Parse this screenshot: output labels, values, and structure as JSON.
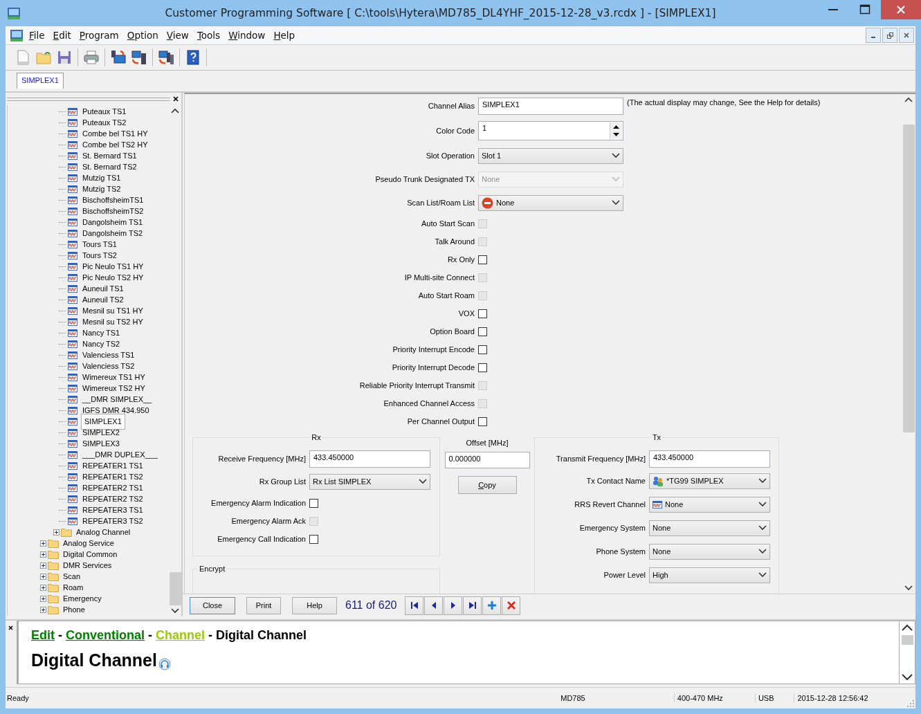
{
  "window": {
    "title": "Customer Programming Software [ C:\\tools\\Hytera\\MD785_DL4YHF_2015-12-28_v3.rcdx ] - [SIMPLEX1]"
  },
  "menu": [
    "File",
    "Edit",
    "Program",
    "Option",
    "View",
    "Tools",
    "Window",
    "Help"
  ],
  "tabs": [
    {
      "label": "SIMPLEX1",
      "selected": true
    }
  ],
  "tree": [
    {
      "children": [
        {
          "children": [
            {
              "label": "Puteaux TS1",
              "selected": false
            },
            {
              "label": "Puteaux TS2",
              "selected": false
            },
            {
              "label": "Combe bel TS1 HY",
              "selected": false
            },
            {
              "label": "Combe bel TS2 HY",
              "selected": false
            },
            {
              "label": "St. Bernard TS1",
              "selected": false
            },
            {
              "label": "St. Bernard TS2",
              "selected": false
            },
            {
              "label": "Mutzig TS1",
              "selected": false
            },
            {
              "label": "Mutzig TS2",
              "selected": false
            },
            {
              "label": "BischoffsheimTS1",
              "selected": false
            },
            {
              "label": "BischoffsheimTS2",
              "selected": false
            },
            {
              "label": "Dangolsheim TS1",
              "selected": false
            },
            {
              "label": "Dangolsheim TS2",
              "selected": false
            },
            {
              "label": "Tours TS1",
              "selected": false
            },
            {
              "label": "Tours TS2",
              "selected": false
            },
            {
              "label": "Pic Neulo TS1 HY",
              "selected": false
            },
            {
              "label": "Pic Neulo TS2 HY",
              "selected": false
            },
            {
              "label": "Auneuil TS1",
              "selected": false
            },
            {
              "label": "Auneuil TS2",
              "selected": false
            },
            {
              "label": "Mesnil su TS1 HY",
              "selected": false
            },
            {
              "label": "Mesnil su TS2 HY",
              "selected": false
            },
            {
              "label": "Nancy TS1",
              "selected": false
            },
            {
              "label": "Nancy TS2",
              "selected": false
            },
            {
              "label": "Valenciess TS1",
              "selected": false
            },
            {
              "label": "Valenciess TS2",
              "selected": false
            },
            {
              "label": "Wimereux TS1 HY",
              "selected": false
            },
            {
              "label": "Wimereux TS2 HY",
              "selected": false
            },
            {
              "label": "__DMR SIMPLEX__",
              "selected": false
            },
            {
              "label": "IGFS DMR 434.950",
              "selected": false
            },
            {
              "label": "SIMPLEX1",
              "selected": true
            },
            {
              "label": "SIMPLEX2",
              "selected": false
            },
            {
              "label": "SIMPLEX3",
              "selected": false
            },
            {
              "label": "___DMR DUPLEX___",
              "selected": false
            },
            {
              "label": "REPEATER1 TS1",
              "selected": false
            },
            {
              "label": "REPEATER1 TS2",
              "selected": false
            },
            {
              "label": "REPEATER2 TS1",
              "selected": false
            },
            {
              "label": "REPEATER2 TS2",
              "selected": false
            },
            {
              "label": "REPEATER3 TS1",
              "selected": false
            },
            {
              "label": "REPEATER3 TS2",
              "selected": false
            }
          ]
        },
        {
          "label": "Analog Channel",
          "expanded": false
        }
      ]
    },
    {
      "label": "Analog Service",
      "expanded": false
    },
    {
      "label": "Digital Common",
      "expanded": false
    },
    {
      "label": "DMR Services",
      "expanded": false
    },
    {
      "label": "Scan",
      "expanded": false
    },
    {
      "label": "Roam",
      "expanded": false
    },
    {
      "label": "Emergency",
      "expanded": false
    },
    {
      "label": "Phone",
      "expanded": false
    }
  ],
  "fields": [
    {
      "kind": "text",
      "label": "Channel Alias",
      "value": "SIMPLEX1",
      "note": "(The actual display may change, See the Help for details)"
    },
    {
      "kind": "spinner",
      "label": "Color Code",
      "value": "1"
    },
    {
      "kind": "select",
      "label": "Slot Operation",
      "value": "Slot 1",
      "disabled": false
    },
    {
      "kind": "select",
      "label": "Pseudo Trunk Designated TX",
      "value": "None",
      "disabled": true
    },
    {
      "kind": "noneselect",
      "label": "Scan List/Roam List",
      "value": "None",
      "disabled": false
    },
    {
      "kind": "checkbox",
      "label": "Auto Start Scan",
      "checked": false,
      "disabled": true
    },
    {
      "kind": "checkbox",
      "label": "Talk Around",
      "checked": false,
      "disabled": true
    },
    {
      "kind": "checkbox",
      "label": "Rx Only",
      "checked": false,
      "disabled": false
    },
    {
      "kind": "checkbox",
      "label": "IP Multi-site Connect",
      "checked": false,
      "disabled": true
    },
    {
      "kind": "checkbox",
      "label": "Auto Start Roam",
      "checked": false,
      "disabled": true
    },
    {
      "kind": "checkbox",
      "label": "VOX",
      "checked": false,
      "disabled": false
    },
    {
      "kind": "checkbox",
      "label": "Option Board",
      "checked": false,
      "disabled": false
    },
    {
      "kind": "checkbox",
      "label": "Priority Interrupt Encode",
      "checked": false,
      "disabled": false
    },
    {
      "kind": "checkbox",
      "label": "Priority Interrupt Decode",
      "checked": false,
      "disabled": false
    },
    {
      "kind": "checkbox",
      "label": "Reliable Priority Interrupt Transmit",
      "checked": false,
      "disabled": true
    },
    {
      "kind": "checkbox",
      "label": "Enhanced Channel Access",
      "checked": false,
      "disabled": true
    },
    {
      "kind": "checkbox",
      "label": "Per Channel Output",
      "checked": false,
      "disabled": false
    }
  ],
  "rx": {
    "title": "Rx",
    "fields": [
      {
        "kind": "text",
        "label": "Receive Frequency [MHz]",
        "value": "433.450000"
      },
      {
        "kind": "select",
        "label": "Rx Group List",
        "value": "Rx List SIMPLEX",
        "disabled": false
      },
      {
        "kind": "checkbox",
        "label": "Emergency Alarm Indication",
        "checked": false,
        "disabled": false
      },
      {
        "kind": "checkbox",
        "label": "Emergency Alarm Ack",
        "checked": false,
        "disabled": true
      },
      {
        "kind": "checkbox",
        "label": "Emergency Call Indication",
        "checked": false,
        "disabled": false
      }
    ]
  },
  "offset": {
    "label": "Offset [MHz]",
    "value": "0.000000",
    "button": "Copy"
  },
  "tx": {
    "title": "Tx",
    "fields": [
      {
        "kind": "text",
        "label": "Transmit Frequency [MHz]",
        "value": "433.450000"
      },
      {
        "kind": "groupselect",
        "label": "Tx Contact Name",
        "value": "*TG99 SIMPLEX",
        "disabled": false
      },
      {
        "kind": "channelselect",
        "label": "RRS Revert Channel",
        "value": "None",
        "disabled": false
      },
      {
        "kind": "select",
        "label": "Emergency System",
        "value": "None",
        "disabled": false
      },
      {
        "kind": "select",
        "label": "Phone System",
        "value": "None",
        "disabled": false
      },
      {
        "kind": "select",
        "label": "Power Level",
        "value": "High",
        "disabled": false
      }
    ]
  },
  "encrypt": {
    "title": "Encrypt"
  },
  "nav": {
    "buttons": [
      "Close",
      "Print",
      "Help"
    ],
    "counter": "611 of 620"
  },
  "help": {
    "breadcrumb": [
      {
        "kind": "link",
        "label": "Edit",
        "color": "#008000"
      },
      {
        "kind": "sep",
        "label": "-"
      },
      {
        "kind": "link",
        "label": "Conventional",
        "color": "#008000"
      },
      {
        "kind": "sep",
        "label": "-"
      },
      {
        "kind": "link",
        "label": "Channel",
        "color": "#99cc00"
      },
      {
        "kind": "sep",
        "label": "-"
      },
      {
        "kind": "current",
        "label": "Digital Channel"
      }
    ],
    "heading": "Digital Channel"
  },
  "status_bar": [
    "Ready",
    "MD785",
    "400-470 MHz",
    "USB",
    "2015-12-28 12:56:42"
  ]
}
